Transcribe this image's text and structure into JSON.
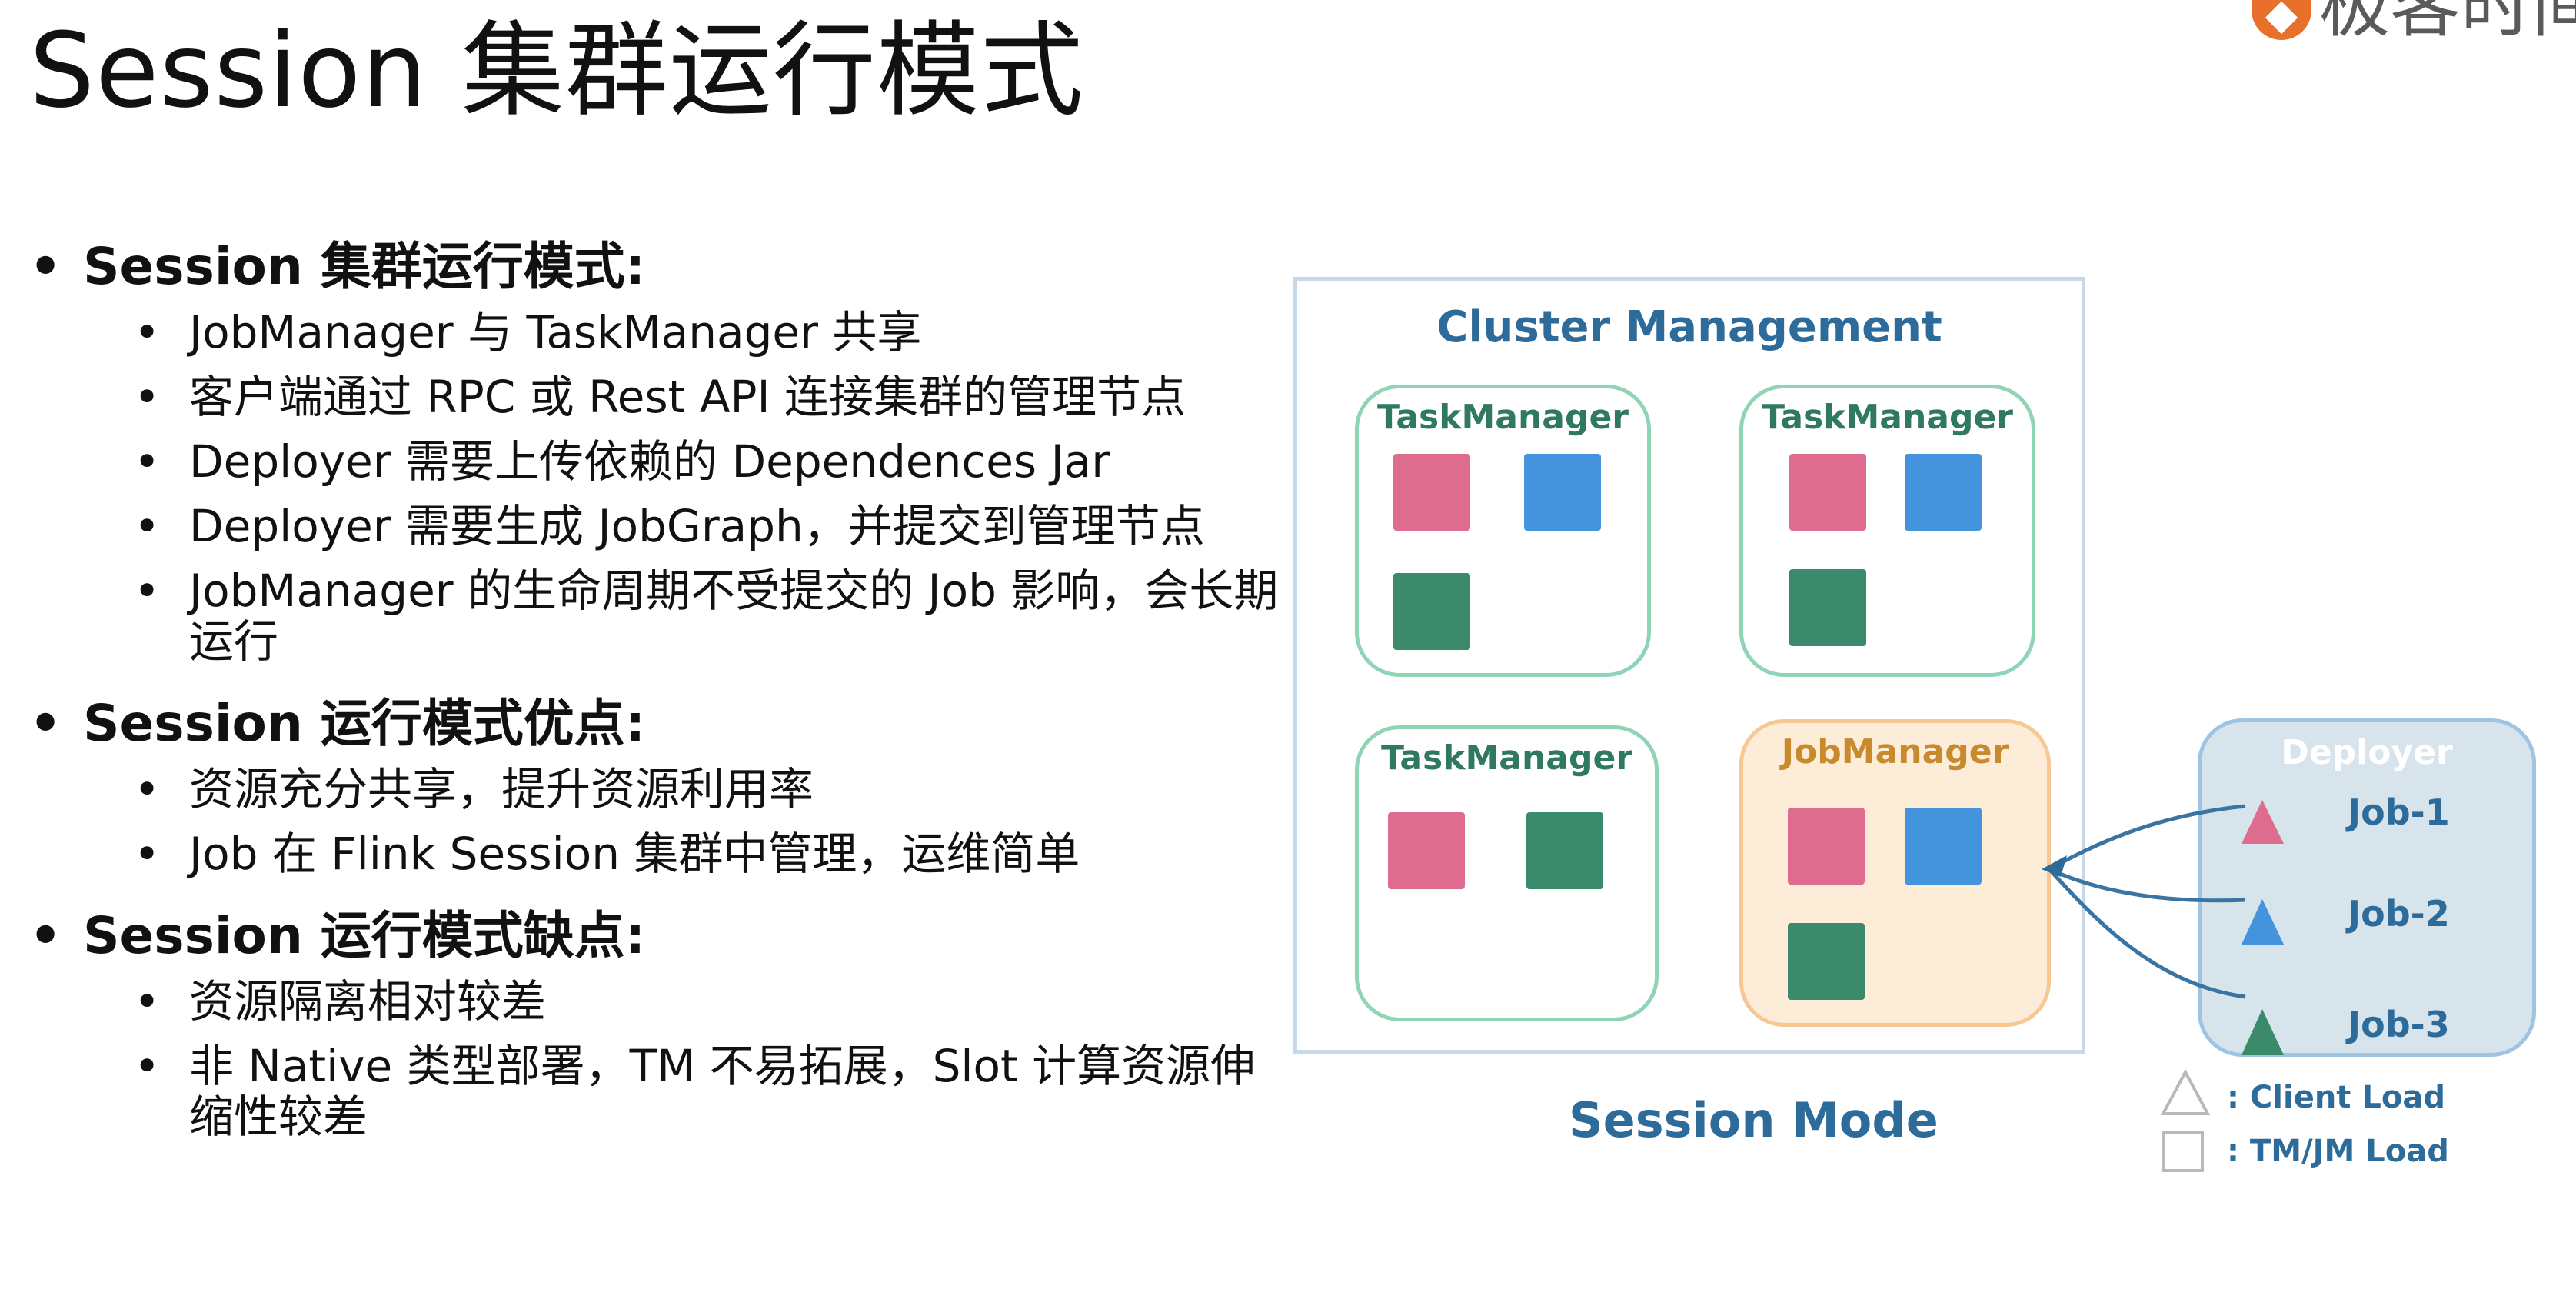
{
  "slide": {
    "title": "Session 集群运行模式",
    "logo_text": "极客时间"
  },
  "bullets": {
    "sections": [
      {
        "heading": "Session 集群运行模式:",
        "items": [
          "JobManager 与 TaskManager 共享",
          "客户端通过 RPC 或 Rest API 连接集群的管理节点",
          "Deployer 需要上传依赖的 Dependences Jar",
          "Deployer 需要生成 JobGraph，并提交到管理节点",
          "JobManager 的生命周期不受提交的 Job 影响，会长期运行"
        ]
      },
      {
        "heading": "Session 运行模式优点:",
        "items": [
          "资源充分共享，提升资源利用率",
          "Job 在 Flink Session 集群中管理，运维简单"
        ]
      },
      {
        "heading": "Session 运行模式缺点:",
        "items": [
          "资源隔离相对较差",
          "非 Native 类型部署，TM 不易拓展，Slot 计算资源伸缩性较差"
        ]
      }
    ]
  },
  "diagram": {
    "cluster_title": "Cluster Management",
    "boxes": [
      {
        "label": "TaskManager",
        "kind": "tm"
      },
      {
        "label": "TaskManager",
        "kind": "tm"
      },
      {
        "label": "TaskManager",
        "kind": "tm"
      },
      {
        "label": "JobManager",
        "kind": "jm"
      }
    ],
    "deployer": {
      "title": "Deployer",
      "jobs": [
        "Job-1",
        "Job-2",
        "Job-3"
      ]
    },
    "caption": "Session Mode",
    "legend": {
      "client_load": ": Client Load",
      "tm_jm_load": ": TM/JM Load"
    },
    "colors": {
      "pink": "#de6c8e",
      "blue": "#4394dc",
      "green": "#3b8a6c",
      "tm_border": "#8fd4b5",
      "jm_border": "#f7c894",
      "jm_fill": "#fcecd8",
      "cluster_border": "#c7d8ea",
      "deployer_fill": "#d7e4ec",
      "text_blue": "#2d6b9a",
      "arrow": "#3a74a3"
    }
  }
}
